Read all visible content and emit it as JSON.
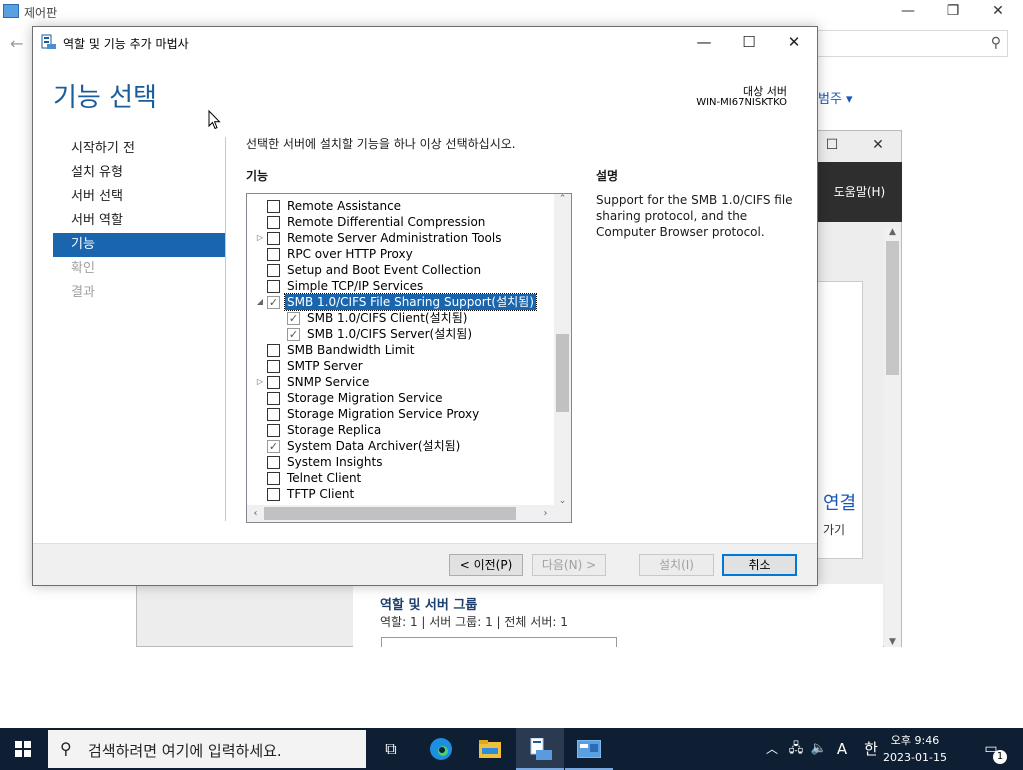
{
  "control_panel": {
    "title": "제어판",
    "partial_link": "범주 ▾"
  },
  "server_manager": {
    "help_menu": "도움말(H)",
    "connect_link": "연결",
    "connect_sub": "가기",
    "group_title": "역할 및 서버 그룹",
    "group_info": "역할: 1   |   서버 그룹: 1   |   전체 서버: 1"
  },
  "wizard": {
    "title": "역할 및 기능 추가 마법사",
    "header": "기능 선택",
    "destination_label": "대상 서버",
    "destination_value": "WIN-MI67NISKTKO",
    "nav": [
      {
        "label": "시작하기 전",
        "state": "normal"
      },
      {
        "label": "설치 유형",
        "state": "normal"
      },
      {
        "label": "서버 선택",
        "state": "normal"
      },
      {
        "label": "서버 역할",
        "state": "normal"
      },
      {
        "label": "기능",
        "state": "active"
      },
      {
        "label": "확인",
        "state": "disabled"
      },
      {
        "label": "결과",
        "state": "disabled"
      }
    ],
    "instruction": "선택한 서버에 설치할 기능을 하나 이상 선택하십시오.",
    "features_label": "기능",
    "description_label": "설명",
    "description_text": "Support for the SMB 1.0/CIFS file sharing protocol, and the Computer Browser protocol.",
    "features": [
      {
        "label": "Remote Assistance",
        "checked": false,
        "expander": "",
        "indent": 0,
        "selected": false
      },
      {
        "label": "Remote Differential Compression",
        "checked": false,
        "expander": "",
        "indent": 0,
        "selected": false
      },
      {
        "label": "Remote Server Administration Tools",
        "checked": false,
        "expander": "▷",
        "indent": 0,
        "selected": false
      },
      {
        "label": "RPC over HTTP Proxy",
        "checked": false,
        "expander": "",
        "indent": 0,
        "selected": false
      },
      {
        "label": "Setup and Boot Event Collection",
        "checked": false,
        "expander": "",
        "indent": 0,
        "selected": false
      },
      {
        "label": "Simple TCP/IP Services",
        "checked": false,
        "expander": "",
        "indent": 0,
        "selected": false
      },
      {
        "label": "SMB 1.0/CIFS File Sharing Support(설치됨)",
        "checked": true,
        "expander": "◢",
        "indent": 0,
        "selected": true
      },
      {
        "label": "SMB 1.0/CIFS Client(설치됨)",
        "checked": true,
        "expander": "",
        "indent": 1,
        "selected": false
      },
      {
        "label": "SMB 1.0/CIFS Server(설치됨)",
        "checked": true,
        "expander": "",
        "indent": 1,
        "selected": false
      },
      {
        "label": "SMB Bandwidth Limit",
        "checked": false,
        "expander": "",
        "indent": 0,
        "selected": false
      },
      {
        "label": "SMTP Server",
        "checked": false,
        "expander": "",
        "indent": 0,
        "selected": false
      },
      {
        "label": "SNMP Service",
        "checked": false,
        "expander": "▷",
        "indent": 0,
        "selected": false
      },
      {
        "label": "Storage Migration Service",
        "checked": false,
        "expander": "",
        "indent": 0,
        "selected": false
      },
      {
        "label": "Storage Migration Service Proxy",
        "checked": false,
        "expander": "",
        "indent": 0,
        "selected": false
      },
      {
        "label": "Storage Replica",
        "checked": false,
        "expander": "",
        "indent": 0,
        "selected": false
      },
      {
        "label": "System Data Archiver(설치됨)",
        "checked": true,
        "expander": "",
        "indent": 0,
        "selected": false
      },
      {
        "label": "System Insights",
        "checked": false,
        "expander": "",
        "indent": 0,
        "selected": false
      },
      {
        "label": "Telnet Client",
        "checked": false,
        "expander": "",
        "indent": 0,
        "selected": false
      },
      {
        "label": "TFTP Client",
        "checked": false,
        "expander": "",
        "indent": 0,
        "selected": false
      }
    ],
    "buttons": {
      "previous": "< 이전(P)",
      "next": "다음(N) >",
      "install": "설치(I)",
      "cancel": "취소"
    }
  },
  "taskbar": {
    "search_placeholder": "검색하려면 여기에 입력하세요.",
    "ime_mode": "A",
    "ime_lang": "한",
    "time": "오후 9:46",
    "date": "2023-01-15",
    "notification_count": "1"
  }
}
